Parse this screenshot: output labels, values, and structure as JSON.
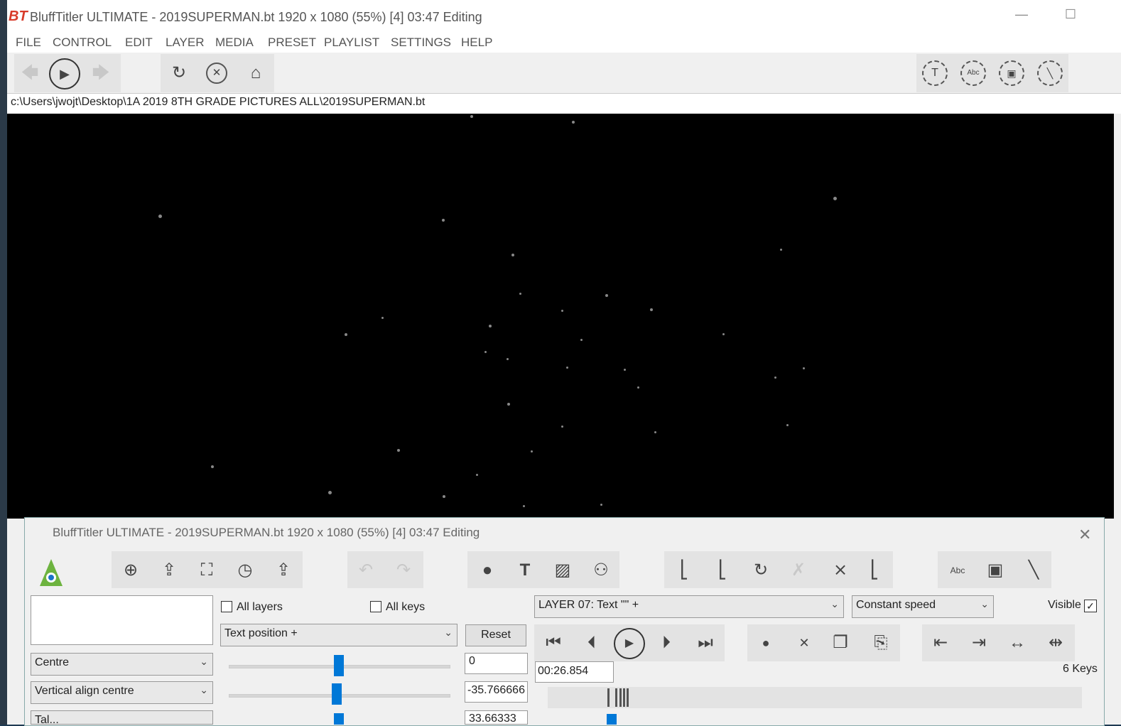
{
  "window": {
    "title": "BluffTitler ULTIMATE  - 2019SUPERMAN.bt 1920 x 1080 (55%) [4] 03:47 Editing",
    "logo": "BT",
    "minimize": "—",
    "maximize": "☐"
  },
  "menu": [
    "FILE",
    "CONTROL",
    "EDIT",
    "LAYER",
    "MEDIA",
    "PRESET",
    "PLAYLIST",
    "SETTINGS",
    "HELP"
  ],
  "toolbar": {
    "back": "🡄",
    "play": "▶",
    "forward": "🡆",
    "refresh": "↻",
    "stop": "✕",
    "home": "⌂",
    "right_icons": [
      "T",
      "Abc",
      "▣",
      "╲"
    ]
  },
  "path": "c:\\Users\\jwojt\\Desktop\\1A 2019 8TH GRADE PICTURES ALL\\2019SUPERMAN.bt",
  "control_window": {
    "title": "BluffTitler ULTIMATE  - 2019SUPERMAN.bt 1920 x 1080 (55%) [4] 03:47 Editing",
    "close": "✕",
    "all_layers_label": "All layers",
    "all_keys_label": "All keys",
    "property_dropdown": "Text position +",
    "reset_label": "Reset",
    "align_dropdown": "Centre",
    "valign_dropdown": "Vertical align centre",
    "third_dropdown": "Tal...",
    "values": [
      "0",
      "-35.766666",
      "33.66333"
    ],
    "layer_dropdown": "LAYER 07: Text \"\" +",
    "speed_dropdown": "Constant speed",
    "visible_label": "Visible",
    "time": "00:26.854",
    "keys_label": "6 Keys",
    "slider_positions": [
      0.5,
      0.47,
      0.5
    ]
  }
}
